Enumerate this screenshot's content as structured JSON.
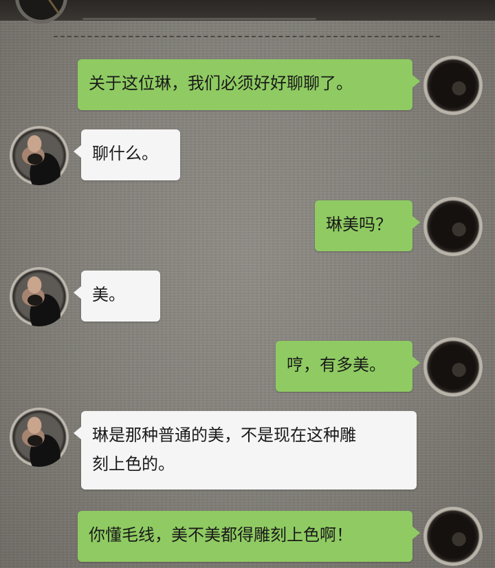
{
  "messages": [
    {
      "side": "me",
      "lines": [
        "关于这位琳，我们必须好好聊聊了。"
      ]
    },
    {
      "side": "them",
      "lines": [
        "聊什么。"
      ]
    },
    {
      "side": "me",
      "lines": [
        "琳美吗？"
      ]
    },
    {
      "side": "them",
      "lines": [
        "美。"
      ]
    },
    {
      "side": "me",
      "lines": [
        "哼，有多美。"
      ]
    },
    {
      "side": "them",
      "lines": [
        "琳是那种普通的美，不是现在这种雕",
        "刻上色的。"
      ]
    },
    {
      "side": "me",
      "lines": [
        "你懂毛线，美不美都得雕刻上色啊！"
      ]
    }
  ]
}
